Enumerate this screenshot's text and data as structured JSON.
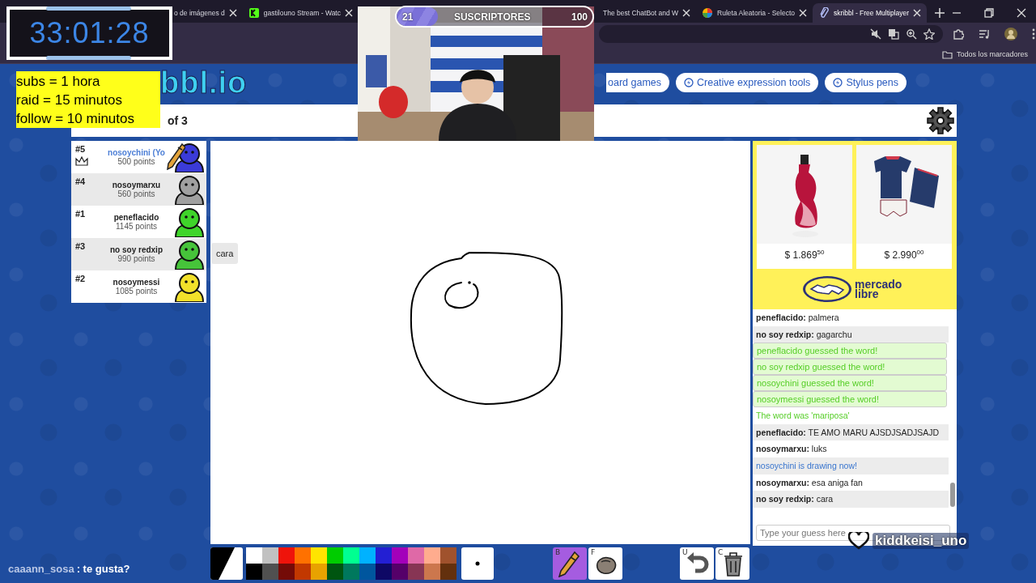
{
  "browser": {
    "tabs": [
      {
        "title": "o de imágenes d",
        "kind": "plain",
        "selected": false
      },
      {
        "title": "gastilouno Stream - Watc",
        "kind": "stream",
        "selected": false
      },
      {
        "title": "The best ChatBot and W",
        "kind": "plain",
        "selected": false
      },
      {
        "title": "Ruleta Aleatoria - Selecto",
        "kind": "wheel",
        "selected": false
      },
      {
        "title": "skribbl - Free Multiplayer",
        "kind": "clip",
        "selected": true
      }
    ],
    "bookmarks": "Todos los marcadores"
  },
  "page": {
    "logo": "bbl.io",
    "nav_links": [
      "oard games",
      "Creative expression tools",
      "Stylus pens"
    ],
    "round": "of 3",
    "players": [
      {
        "rank": "#5",
        "name": "nosoychini (Yo",
        "points": "500 points",
        "color": "#3b3bd8",
        "you": true,
        "drawing": true,
        "owner": true
      },
      {
        "rank": "#4",
        "name": "nosoymarxu",
        "points": "560 points",
        "color": "#a0a0a0",
        "you": false,
        "drawing": false,
        "owner": false
      },
      {
        "rank": "#1",
        "name": "peneflacido",
        "points": "1145 points",
        "color": "#3fd52a",
        "you": false,
        "drawing": false,
        "owner": false
      },
      {
        "rank": "#3",
        "name": "no soy redxip",
        "points": "990 points",
        "color": "#46c43a",
        "you": false,
        "drawing": false,
        "owner": false
      },
      {
        "rank": "#2",
        "name": "nosoymessi",
        "points": "1085 points",
        "color": "#f2e12a",
        "you": false,
        "drawing": false,
        "owner": false
      }
    ],
    "speech_bubble": "cara",
    "ads": [
      {
        "price": "$ 1.869",
        "cents": "50",
        "kind": "perfume"
      },
      {
        "price": "$ 2.990",
        "cents": "00",
        "kind": "jersey"
      }
    ],
    "ad_brand": "mercado libre",
    "chat": [
      {
        "kind": "message",
        "text": "**peneflacido:** palmera"
      },
      {
        "kind": "message",
        "text": "**no soy redxip:** gagarchu"
      },
      {
        "kind": "guessed",
        "text": "peneflacido guessed the word!"
      },
      {
        "kind": "guessed",
        "text": "no soy redxip guessed the word!"
      },
      {
        "kind": "guessed",
        "text": "nosoychini guessed the word!"
      },
      {
        "kind": "guessed",
        "text": "nosoymessi guessed the word!"
      },
      {
        "kind": "word",
        "text": "The word was 'mariposa'"
      },
      {
        "kind": "message",
        "text": "**peneflacido:** TE AMO MARU AJSDJSADJSAJD"
      },
      {
        "kind": "message",
        "text": "**nosoymarxu:** luks"
      },
      {
        "kind": "drawing",
        "text": "nosoychini is drawing now!"
      },
      {
        "kind": "message",
        "text": "**nosoymarxu:** esa aniga fan"
      },
      {
        "kind": "message",
        "text": "**no soy redxip:** cara"
      }
    ],
    "chat_input": {
      "placeholder": "Type your guess here"
    },
    "current_color": {
      "color": "#000000"
    },
    "palette": [
      {
        "color": "#ffffff"
      },
      {
        "color": "#c1c1c1"
      },
      {
        "color": "#ef130b"
      },
      {
        "color": "#ff7100"
      },
      {
        "color": "#ffe400"
      },
      {
        "color": "#00cc00"
      },
      {
        "color": "#00ff91"
      },
      {
        "color": "#00b2ff"
      },
      {
        "color": "#231fd3"
      },
      {
        "color": "#a300ba"
      },
      {
        "color": "#df69a7"
      },
      {
        "color": "#ffac8e"
      },
      {
        "color": "#a0522d"
      },
      {
        "color": "#000000"
      },
      {
        "color": "#505050"
      },
      {
        "color": "#740b07"
      },
      {
        "color": "#c23800"
      },
      {
        "color": "#e8a200"
      },
      {
        "color": "#005510"
      },
      {
        "color": "#00785d"
      },
      {
        "color": "#00569e"
      },
      {
        "color": "#0e0865"
      },
      {
        "color": "#550069"
      },
      {
        "color": "#873554"
      },
      {
        "color": "#cc774d"
      },
      {
        "color": "#63300d"
      }
    ],
    "tools": [
      {
        "key": "B",
        "kind": "pencil",
        "selected": true
      },
      {
        "key": "F",
        "kind": "fill",
        "selected": false
      }
    ],
    "actions": [
      {
        "key": "U",
        "kind": "undo"
      },
      {
        "key": "C",
        "kind": "clear"
      }
    ]
  },
  "stream_overlay": {
    "timer": "33:01:28",
    "goals": [
      "subs = 1 hora",
      "raid = 15 minutos",
      "follow = 10 minutos"
    ],
    "sub_goal": {
      "current": "21",
      "label": "SUSCRIPTORES",
      "target": "100",
      "level": 0.21
    },
    "chat_message": {
      "user": "caaann_sosa",
      "text": ": te gusta?"
    },
    "follower": "kiddkeisi_uno"
  }
}
